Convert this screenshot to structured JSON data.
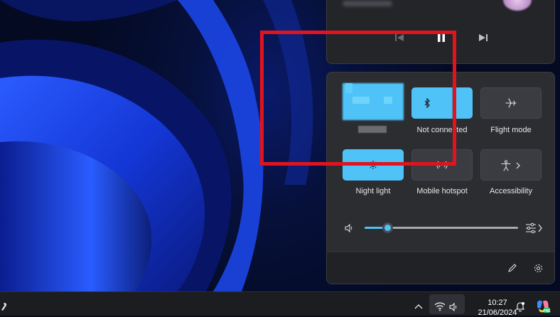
{
  "quick_settings": {
    "tiles": [
      {
        "label": "",
        "icon": "wifi-icon",
        "active": true
      },
      {
        "label": "Not connected",
        "icon": "bluetooth-icon",
        "active": true
      },
      {
        "label": "Flight mode",
        "icon": "airplane-icon",
        "active": false
      },
      {
        "label": "Night light",
        "icon": "night-light-icon",
        "active": true
      },
      {
        "label": "Mobile hotspot",
        "icon": "hotspot-icon",
        "active": false
      },
      {
        "label": "Accessibility",
        "icon": "accessibility-icon",
        "active": false
      }
    ],
    "volume": {
      "level": 0.15
    },
    "footer": {
      "edit_icon": "pencil-icon",
      "settings_icon": "gear-icon"
    }
  },
  "media": {
    "controls": [
      "previous-icon",
      "pause-icon",
      "next-icon"
    ]
  },
  "taskbar": {
    "time": "10:27",
    "date": "21/06/2024"
  },
  "colors": {
    "accent": "#4fc3f7",
    "highlight": "#e1141e",
    "panel": "#2b2d31"
  }
}
